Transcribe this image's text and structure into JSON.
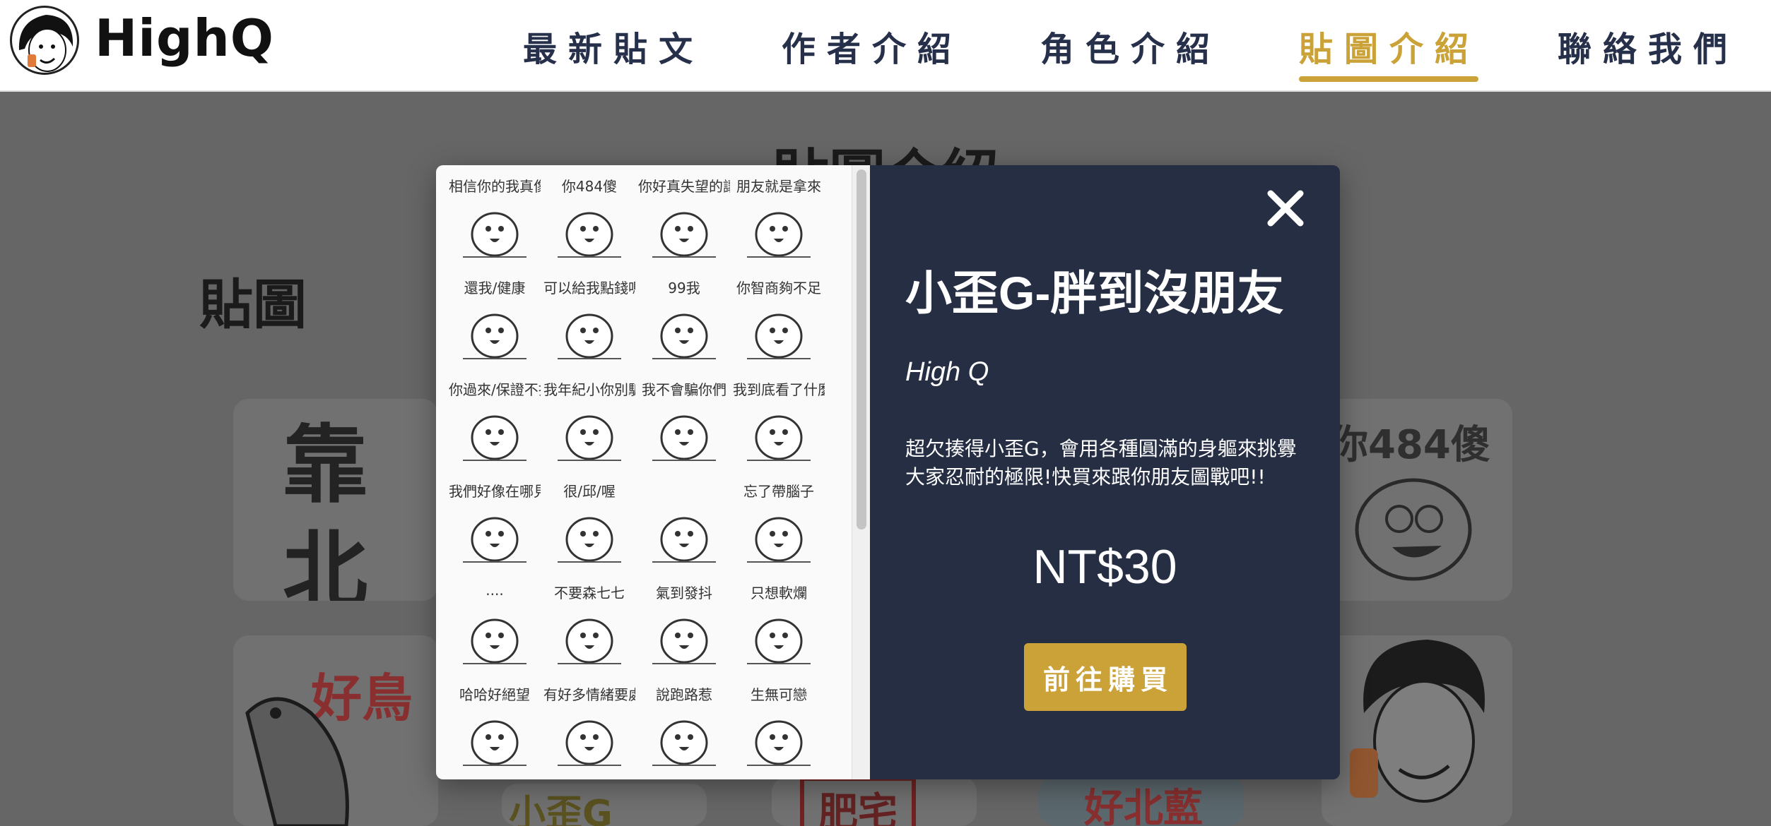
{
  "brand": {
    "name": "HighQ"
  },
  "nav": {
    "items": [
      {
        "label": "最新貼文",
        "active": false
      },
      {
        "label": "作者介紹",
        "active": false
      },
      {
        "label": "角色介紹",
        "active": false
      },
      {
        "label": "貼圖介紹",
        "active": true
      },
      {
        "label": "聯絡我們",
        "active": false
      }
    ],
    "accent_color": "#caa238"
  },
  "page": {
    "title": "貼圖介紹",
    "section_heading": "貼圖",
    "cards": [
      {
        "text": "靠北"
      },
      {
        "text": "你484傻"
      },
      {
        "text": "好鳥"
      },
      {
        "text": "小歪G"
      },
      {
        "text": "肥宅"
      },
      {
        "text": "好北藍"
      }
    ]
  },
  "modal": {
    "stickers": [
      "相信你的我真像智障",
      "你484傻",
      "你好真失望的讓我",
      "朋友就是拿來",
      "還我/健康",
      "可以給我點錢嗎",
      "99我",
      "你智商夠不足",
      "你過來/保證不打你",
      "我年紀小你別騙我",
      "我不會騙你們",
      "我到底看了什麼?",
      "我們好像在哪見過",
      "很/邱/喔",
      "",
      "忘了帶腦子",
      "....",
      "不要森七七",
      "氣到發抖",
      "只想軟爛",
      "哈哈好絕望",
      "有好多情緒要處理",
      "說跑路惹",
      "生無可戀"
    ],
    "title": "小歪G-胖到沒朋友",
    "author": "High Q",
    "description": "超欠揍得小歪G，會用各種圓滿的身軀來挑釁大家忍耐的極限!快買來跟你朋友圖戰吧!!",
    "price": "NT$30",
    "buy_label": "前往購買",
    "close_icon": "close-icon",
    "panel_color": "#262e44"
  }
}
